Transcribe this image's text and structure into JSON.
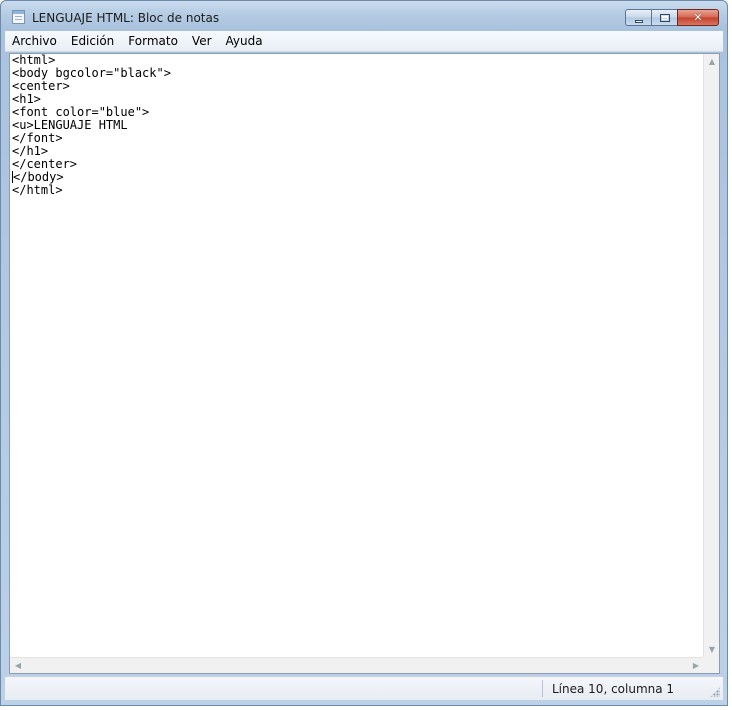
{
  "window": {
    "title": "LENGUAJE HTML: Bloc de notas",
    "app_icon": "notepad-icon"
  },
  "controls": {
    "minimize_icon": "minimize-icon",
    "maximize_icon": "maximize-icon",
    "close_icon": "close-icon",
    "close_glyph": "✕"
  },
  "menu": {
    "items": [
      {
        "label": "Archivo"
      },
      {
        "label": "Edición"
      },
      {
        "label": "Formato"
      },
      {
        "label": "Ver"
      },
      {
        "label": "Ayuda"
      }
    ]
  },
  "editor": {
    "lines": [
      "<html>",
      "<body bgcolor=\"black\">",
      "<center>",
      "<h1>",
      "<font color=\"blue\">",
      "<u>LENGUAJE HTML",
      "</font>",
      "</h1>",
      "</center>",
      "</body>",
      "</html>"
    ],
    "caret_line": 10
  },
  "scrollbars": {
    "up_arrow": "▲",
    "down_arrow": "▼",
    "left_arrow": "◀",
    "right_arrow": "▶"
  },
  "status": {
    "position": "Línea 10, columna 1"
  },
  "colors": {
    "title_bar": "#b4cbe3",
    "close_button": "#c4412a"
  }
}
